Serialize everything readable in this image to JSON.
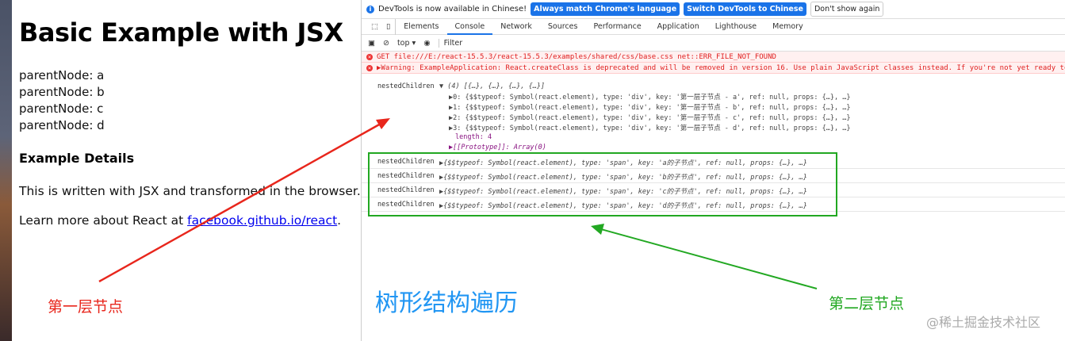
{
  "page": {
    "title": "Basic Example with JSX",
    "parent_nodes": [
      "parentNode:  a",
      "parentNode:  b",
      "parentNode:  c",
      "parentNode:  d"
    ],
    "details_heading": "Example Details",
    "para1": "This is written with JSX and transformed in the browser.",
    "para2_prefix": "Learn more about React at ",
    "link": "facebook.github.io/react",
    "para2_suffix": "."
  },
  "devtools": {
    "infobar": {
      "message": "DevTools is now available in Chinese!",
      "btn1": "Always match Chrome's language",
      "btn2": "Switch DevTools to Chinese",
      "btn3": "Don't show again"
    },
    "tabs": [
      "Elements",
      "Console",
      "Network",
      "Sources",
      "Performance",
      "Application",
      "Lighthouse",
      "Memory"
    ],
    "toolbar": {
      "context": "top ▾",
      "filter_placeholder": "Filter"
    },
    "errors": [
      "GET file:///E:/react-15.5.3/react-15.5.3/examples/shared/css/base.css net::ERR_FILE_NOT_FOUND",
      "▶Warning: ExampleApplication: React.createClass is deprecated and will be removed in version 16. Use plain JavaScript classes instead. If you're not yet ready to mi"
    ],
    "array_log": {
      "label": "nestedChildren",
      "summary": "▼ (4) [{…}, {…}, {…}, {…}]",
      "items": [
        "▶0: {$$typeof: Symbol(react.element), type: 'div', key: '第一层子节点 - a', ref: null, props: {…}, …}",
        "▶1: {$$typeof: Symbol(react.element), type: 'div', key: '第一层子节点 - b', ref: null, props: {…}, …}",
        "▶2: {$$typeof: Symbol(react.element), type: 'div', key: '第一层子节点 - c', ref: null, props: {…}, …}",
        "▶3: {$$typeof: Symbol(react.element), type: 'div', key: '第一层子节点 - d', ref: null, props: {…}, …}"
      ],
      "length": "length: 4",
      "prototype": "▶[[Prototype]]: Array(0)"
    },
    "child_logs": [
      {
        "label": "nestedChildren",
        "value": "▶{$$typeof: Symbol(react.element), type: 'span', key: 'a的子节点', ref: null, props: {…}, …}"
      },
      {
        "label": "nestedChildren",
        "value": "▶{$$typeof: Symbol(react.element), type: 'span', key: 'b的子节点', ref: null, props: {…}, …}"
      },
      {
        "label": "nestedChildren",
        "value": "▶{$$typeof: Symbol(react.element), type: 'span', key: 'c的子节点', ref: null, props: {…}, …}"
      },
      {
        "label": "nestedChildren",
        "value": "▶{$$typeof: Symbol(react.element), type: 'span', key: 'd的子节点', ref: null, props: {…}, …}"
      }
    ]
  },
  "annotations": {
    "first_level": "第一层节点",
    "second_level": "第二层节点",
    "title": "树形结构遍历",
    "watermark": "@稀土掘金技术社区"
  },
  "colors": {
    "red": "#e8261c",
    "green": "#22a822",
    "blue": "#2196f3"
  }
}
